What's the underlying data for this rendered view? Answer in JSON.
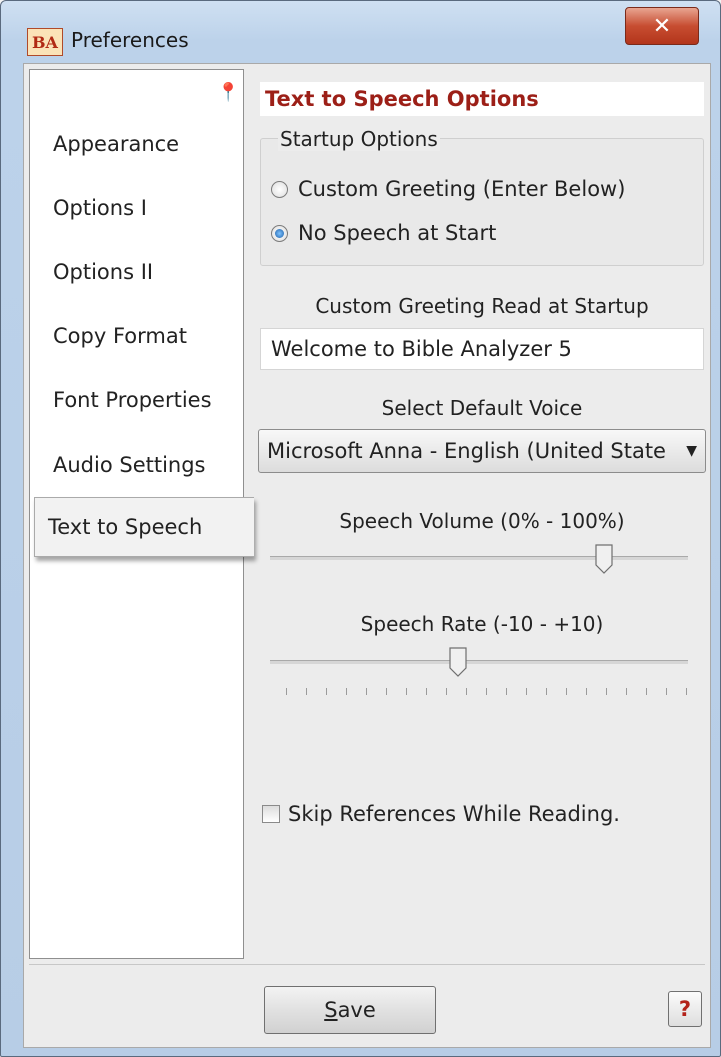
{
  "window": {
    "title": "Preferences",
    "app_icon_text": "BA",
    "close_label": "x"
  },
  "nav": {
    "items": [
      {
        "label": "Appearance"
      },
      {
        "label": "Options I"
      },
      {
        "label": "Options II"
      },
      {
        "label": "Copy Format"
      },
      {
        "label": "Font Properties"
      },
      {
        "label": "Audio Settings"
      },
      {
        "label": "Text to Speech"
      }
    ],
    "selected": "Text to Speech"
  },
  "panel": {
    "title": "Text to Speech Options",
    "startup": {
      "legend": "Startup Options",
      "options": [
        {
          "label": "Custom Greeting (Enter Below)",
          "checked": false
        },
        {
          "label": "No Speech at Start",
          "checked": true
        }
      ]
    },
    "greeting_label": "Custom Greeting Read at Startup",
    "greeting_value": "Welcome to Bible Analyzer 5",
    "voice_label": "Select Default Voice",
    "voice_value": "Microsoft Anna - English (United State",
    "volume_label": "Speech Volume (0% - 100%)",
    "volume_value": 0.8,
    "rate_label": "Speech Rate (-10 - +10)",
    "rate_value": -1,
    "skip_label": "Skip References While Reading.",
    "skip_checked": false
  },
  "footer": {
    "save_label": "ave",
    "save_accel": "S",
    "help_label": "?"
  }
}
